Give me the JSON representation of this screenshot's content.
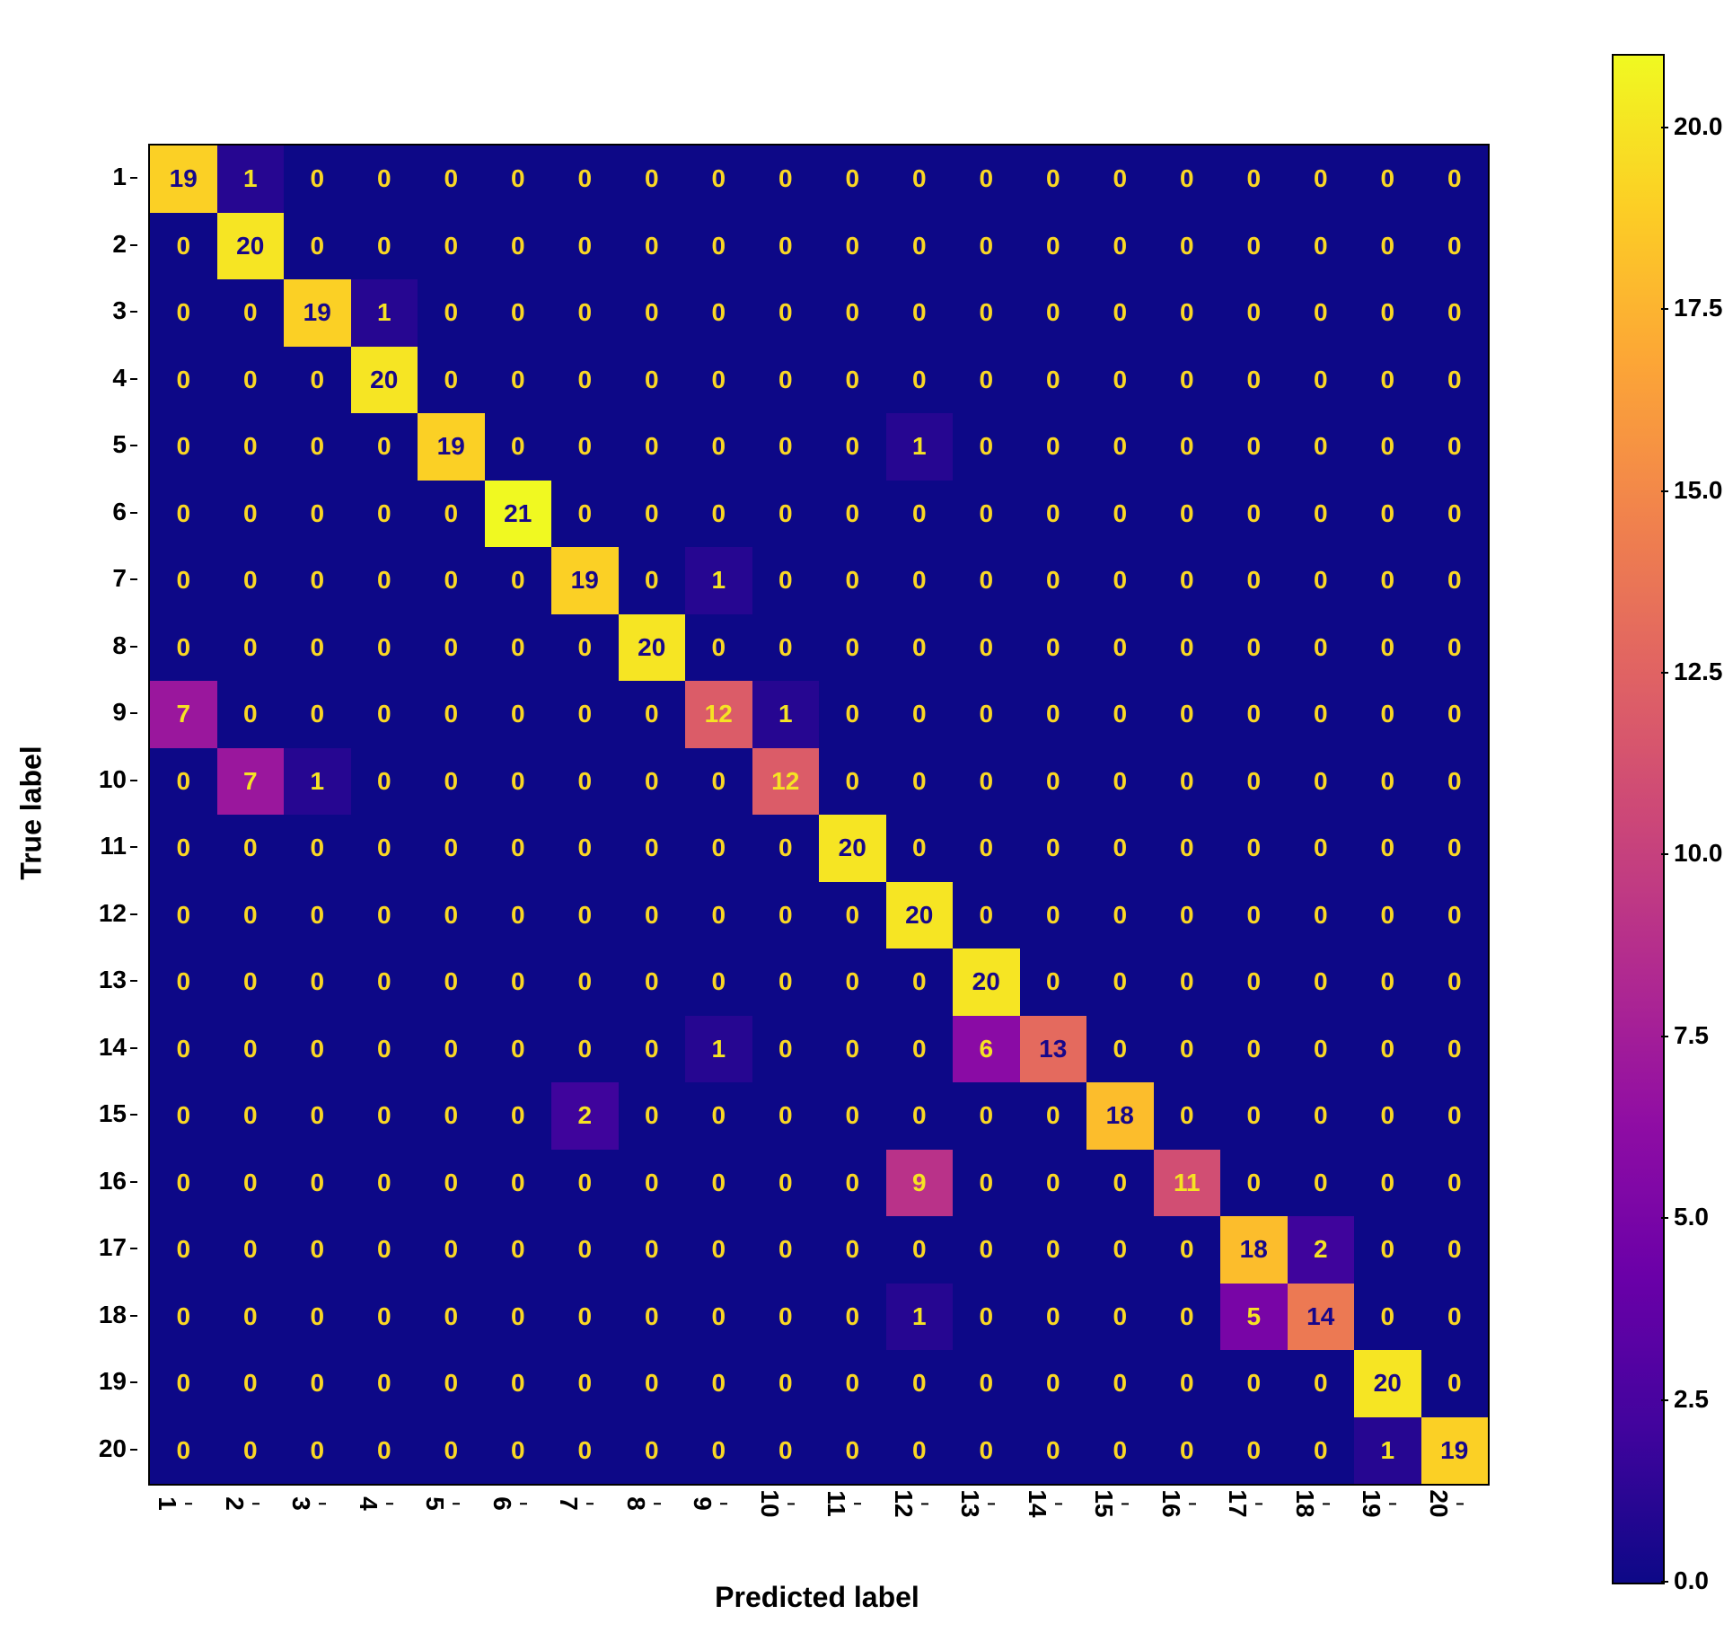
{
  "chart_data": {
    "type": "heatmap",
    "title": "",
    "xlabel": "Predicted label",
    "ylabel": "True label",
    "x_categories": [
      "1",
      "2",
      "3",
      "4",
      "5",
      "6",
      "7",
      "8",
      "9",
      "10",
      "11",
      "12",
      "13",
      "14",
      "15",
      "16",
      "17",
      "18",
      "19",
      "20"
    ],
    "y_categories": [
      "1",
      "2",
      "3",
      "4",
      "5",
      "6",
      "7",
      "8",
      "9",
      "10",
      "11",
      "12",
      "13",
      "14",
      "15",
      "16",
      "17",
      "18",
      "19",
      "20"
    ],
    "matrix": [
      [
        19,
        1,
        0,
        0,
        0,
        0,
        0,
        0,
        0,
        0,
        0,
        0,
        0,
        0,
        0,
        0,
        0,
        0,
        0,
        0
      ],
      [
        0,
        20,
        0,
        0,
        0,
        0,
        0,
        0,
        0,
        0,
        0,
        0,
        0,
        0,
        0,
        0,
        0,
        0,
        0,
        0
      ],
      [
        0,
        0,
        19,
        1,
        0,
        0,
        0,
        0,
        0,
        0,
        0,
        0,
        0,
        0,
        0,
        0,
        0,
        0,
        0,
        0
      ],
      [
        0,
        0,
        0,
        20,
        0,
        0,
        0,
        0,
        0,
        0,
        0,
        0,
        0,
        0,
        0,
        0,
        0,
        0,
        0,
        0
      ],
      [
        0,
        0,
        0,
        0,
        19,
        0,
        0,
        0,
        0,
        0,
        0,
        1,
        0,
        0,
        0,
        0,
        0,
        0,
        0,
        0
      ],
      [
        0,
        0,
        0,
        0,
        0,
        21,
        0,
        0,
        0,
        0,
        0,
        0,
        0,
        0,
        0,
        0,
        0,
        0,
        0,
        0
      ],
      [
        0,
        0,
        0,
        0,
        0,
        0,
        19,
        0,
        1,
        0,
        0,
        0,
        0,
        0,
        0,
        0,
        0,
        0,
        0,
        0
      ],
      [
        0,
        0,
        0,
        0,
        0,
        0,
        0,
        20,
        0,
        0,
        0,
        0,
        0,
        0,
        0,
        0,
        0,
        0,
        0,
        0
      ],
      [
        7,
        0,
        0,
        0,
        0,
        0,
        0,
        0,
        12,
        1,
        0,
        0,
        0,
        0,
        0,
        0,
        0,
        0,
        0,
        0
      ],
      [
        0,
        7,
        1,
        0,
        0,
        0,
        0,
        0,
        0,
        12,
        0,
        0,
        0,
        0,
        0,
        0,
        0,
        0,
        0,
        0
      ],
      [
        0,
        0,
        0,
        0,
        0,
        0,
        0,
        0,
        0,
        0,
        20,
        0,
        0,
        0,
        0,
        0,
        0,
        0,
        0,
        0
      ],
      [
        0,
        0,
        0,
        0,
        0,
        0,
        0,
        0,
        0,
        0,
        0,
        20,
        0,
        0,
        0,
        0,
        0,
        0,
        0,
        0
      ],
      [
        0,
        0,
        0,
        0,
        0,
        0,
        0,
        0,
        0,
        0,
        0,
        0,
        20,
        0,
        0,
        0,
        0,
        0,
        0,
        0
      ],
      [
        0,
        0,
        0,
        0,
        0,
        0,
        0,
        0,
        1,
        0,
        0,
        0,
        6,
        13,
        0,
        0,
        0,
        0,
        0,
        0
      ],
      [
        0,
        0,
        0,
        0,
        0,
        0,
        2,
        0,
        0,
        0,
        0,
        0,
        0,
        0,
        18,
        0,
        0,
        0,
        0,
        0
      ],
      [
        0,
        0,
        0,
        0,
        0,
        0,
        0,
        0,
        0,
        0,
        0,
        9,
        0,
        0,
        0,
        11,
        0,
        0,
        0,
        0
      ],
      [
        0,
        0,
        0,
        0,
        0,
        0,
        0,
        0,
        0,
        0,
        0,
        0,
        0,
        0,
        0,
        0,
        18,
        2,
        0,
        0
      ],
      [
        0,
        0,
        0,
        0,
        0,
        0,
        0,
        0,
        0,
        0,
        0,
        1,
        0,
        0,
        0,
        0,
        5,
        14,
        0,
        0
      ],
      [
        0,
        0,
        0,
        0,
        0,
        0,
        0,
        0,
        0,
        0,
        0,
        0,
        0,
        0,
        0,
        0,
        0,
        0,
        20,
        0
      ],
      [
        0,
        0,
        0,
        0,
        0,
        0,
        0,
        0,
        0,
        0,
        0,
        0,
        0,
        0,
        0,
        0,
        0,
        0,
        1,
        19
      ]
    ],
    "vmin": 0.0,
    "vmax": 21.0,
    "colormap": "plasma",
    "colorbar_ticks": [
      "0.0",
      "2.5",
      "5.0",
      "7.5",
      "10.0",
      "12.5",
      "15.0",
      "17.5",
      "20.0"
    ]
  }
}
